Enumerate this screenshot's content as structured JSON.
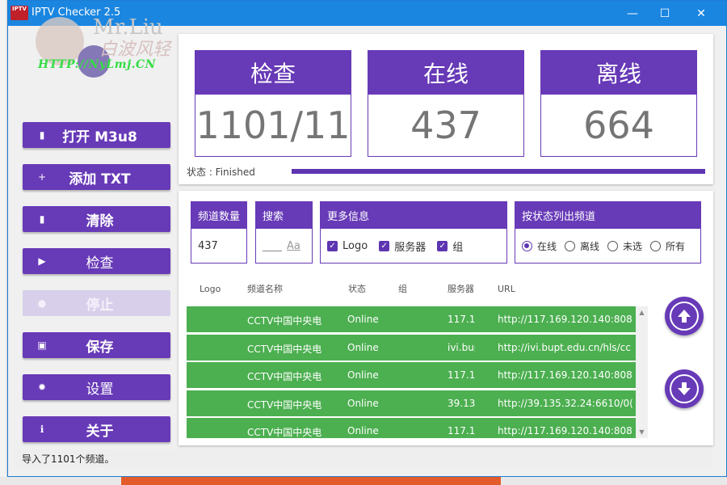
{
  "window": {
    "title": "IPTV Checker 2.5",
    "icon_text": "IPTV"
  },
  "watermark": {
    "brand": "Mr.Liu",
    "brand_cn": "白波风轻",
    "url": "HTTP://NyLmj.CN"
  },
  "sidebar": {
    "buttons": [
      {
        "label": "打开 M3u8",
        "icon": "file-plus-icon",
        "glyph": "▮"
      },
      {
        "label": "添加 TXT",
        "icon": "plus-icon",
        "glyph": "+"
      },
      {
        "label": "清除",
        "icon": "trash-icon",
        "glyph": "▮"
      },
      {
        "label": "检查",
        "icon": "play-icon",
        "glyph": "▶"
      },
      {
        "label": "停止",
        "icon": "stop-icon",
        "glyph": "●"
      },
      {
        "label": "保存",
        "icon": "save-icon",
        "glyph": "▣"
      },
      {
        "label": "设置",
        "icon": "gear-icon",
        "glyph": "✹"
      },
      {
        "label": "关于",
        "icon": "info-icon",
        "glyph": "ℹ"
      }
    ]
  },
  "stats": {
    "check": {
      "label": "检查",
      "value": "1101/11"
    },
    "online": {
      "label": "在线",
      "value": "437"
    },
    "offline": {
      "label": "离线",
      "value": "664"
    },
    "status_text": "状态 : Finished",
    "progress": 1.0
  },
  "filters": {
    "channel_count": {
      "label": "频道数量",
      "value": "437"
    },
    "search": {
      "label": "搜索",
      "placeholder": "Aa"
    },
    "more_info": {
      "label": "更多信息",
      "options": [
        "Logo",
        "服务器",
        "组"
      ]
    },
    "by_status": {
      "label": "按状态列出频道",
      "options": [
        "在线",
        "离线",
        "未选",
        "所有"
      ],
      "selected": "在线"
    }
  },
  "table": {
    "columns": [
      "Logo",
      "频道名称",
      "状态",
      "组",
      "服务器",
      "URL"
    ],
    "rows": [
      {
        "name": "CCTV中国中央电",
        "status": "Online",
        "server": "117.1(",
        "url": "http://117.169.120.140:808"
      },
      {
        "name": "CCTV中国中央电",
        "status": "Online",
        "server": "ivi.bup",
        "url": "http://ivi.bupt.edu.cn/hls/cc"
      },
      {
        "name": "CCTV中国中央电",
        "status": "Online",
        "server": "117.1(",
        "url": "http://117.169.120.140:808"
      },
      {
        "name": "CCTV中国中央电",
        "status": "Online",
        "server": "39.13!",
        "url": "http://39.135.32.24:6610/0("
      },
      {
        "name": "CCTV中国中央电",
        "status": "Online",
        "server": "117.1(",
        "url": "http://117.169.120.140:808"
      }
    ]
  },
  "statusbar": {
    "text": "导入了1101个频道。"
  },
  "colors": {
    "accent": "#673ab7",
    "online_row": "#4caf50",
    "titlebar": "#1a86e0"
  }
}
